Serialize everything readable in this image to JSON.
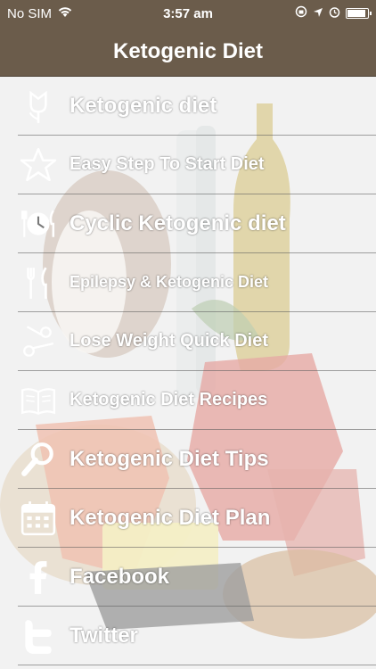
{
  "status_bar": {
    "carrier": "No SIM",
    "time": "3:57 am",
    "battery_level": 0.9
  },
  "nav": {
    "title": "Ketogenic Diet"
  },
  "colors": {
    "nav_background": "#6b5c4b",
    "menu_text": "#ffffff"
  },
  "menu": [
    {
      "label": "Ketogenic diet",
      "icon": "tulip-icon"
    },
    {
      "label": "Easy Step To Start Diet",
      "icon": "star-icon"
    },
    {
      "label": "Cyclic Ketogenic diet",
      "icon": "plate-clock-icon"
    },
    {
      "label": "Epilepsy & Ketogenic Diet",
      "icon": "fork-knife-icon"
    },
    {
      "label": "Lose Weight Quick Diet",
      "icon": "scissors-icon"
    },
    {
      "label": "Ketogenic Diet Recipes",
      "icon": "book-icon"
    },
    {
      "label": "Ketogenic Diet Tips",
      "icon": "magnifier-icon"
    },
    {
      "label": "Ketogenic Diet Plan",
      "icon": "calendar-icon"
    },
    {
      "label": "Facebook",
      "icon": "facebook-icon"
    },
    {
      "label": "Twitter",
      "icon": "twitter-icon"
    }
  ]
}
